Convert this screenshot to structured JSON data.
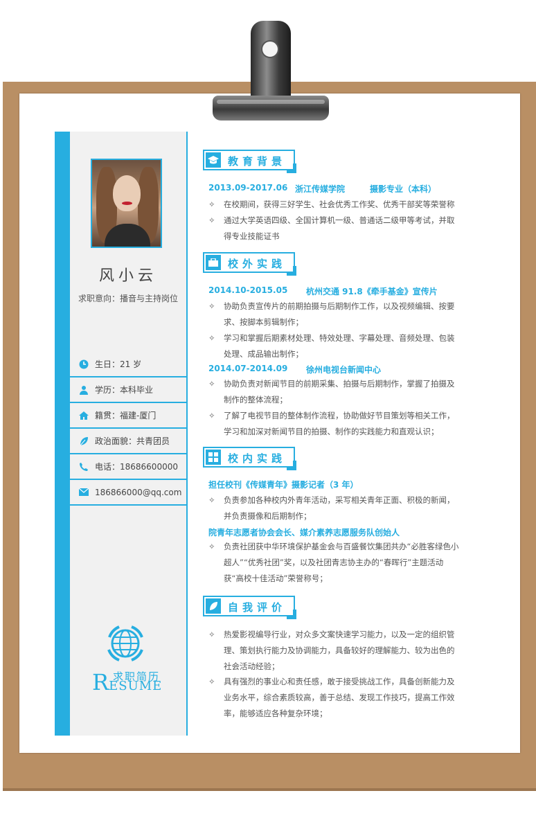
{
  "profile": {
    "name": "风小云",
    "intent": "求职意向：播音与主持岗位",
    "birth": "生日：21 岁",
    "education": "学历：本科毕业",
    "hometown": "籍贯：福建-厦门",
    "politics": "政治面貌：共青团员",
    "phone": "电话：18686600000",
    "email": "186866000@qq.com"
  },
  "logo": {
    "cn": "求职简历",
    "en_big": "R",
    "en_rest": "ESUME"
  },
  "sections": {
    "education": {
      "title": "教育背景",
      "date": "2013.09-2017.06",
      "school": "浙江传媒学院",
      "major": "摄影专业（本科）",
      "items": [
        "在校期间，获得三好学生、社会优秀工作奖、优秀干部奖等荣誉称",
        "通过大学英语四级、全国计算机一级、普通话二级甲等考试，并取得专业技能证书"
      ]
    },
    "outside": {
      "title": "校外实践",
      "job1_date": "2014.10-2015.05",
      "job1_org": "杭州交通 91.8《牵手基金》宣传片",
      "job1_items": [
        "协助负责宣传片的前期拍摄与后期制作工作，以及视频编辑、按要求、按脚本剪辑制作；",
        "学习和掌握后期素材处理、特效处理、字幕处理、音频处理、包装处理、成品输出制作；"
      ],
      "job2_date": "2014.07-2014.09",
      "job2_org": "徐州电视台新闻中心",
      "job2_items": [
        "协助负责对新闻节目的前期采集、拍摄与后期制作，掌握了拍摄及制作的整体流程；",
        "了解了电视节目的整体制作流程，协助做好节目策划等相关工作，学习和加深对新闻节目的拍摄、制作的实践能力和直观认识；"
      ]
    },
    "campus": {
      "title": "校内实践",
      "role1": "担任校刊《传媒青年》摄影记者（3 年）",
      "role1_items": [
        "负责参加各种校内外青年活动，采写相关青年正面、积极的新闻，并负责摄像和后期制作；"
      ],
      "role2": "院青年志愿者协会会长、媒介素养志愿服务队创始人",
      "role2_items": [
        "负责社团获中华环境保护基金会与百盛餐饮集团共办“必胜客绿色小超人”“优秀社团”奖，以及社团青志协主办的“春晖行”主题活动获“高校十佳活动”荣誉称号；"
      ]
    },
    "self": {
      "title": "自我评价",
      "items": [
        "热爱影视编导行业，对众多文案快速学习能力，以及一定的组织管理、策划执行能力及协调能力，具备较好的理解能力、较为出色的社会活动经验；",
        "具有强烈的事业心和责任感，敢于接受挑战工作，具备创新能力及业务水平，综合素质较高，善于总结、发现工作技巧，提高工作效率，能够适应各种复杂环境；"
      ]
    }
  },
  "colors": {
    "accent": "#27aee0",
    "board": "#b98f64"
  },
  "icons": [
    "clock-icon",
    "person-icon",
    "home-icon",
    "leaf-icon",
    "phone-icon",
    "mail-icon",
    "graduation-cap-icon",
    "briefcase-icon",
    "grid-icon",
    "leaf-icon",
    "globe-icon"
  ]
}
